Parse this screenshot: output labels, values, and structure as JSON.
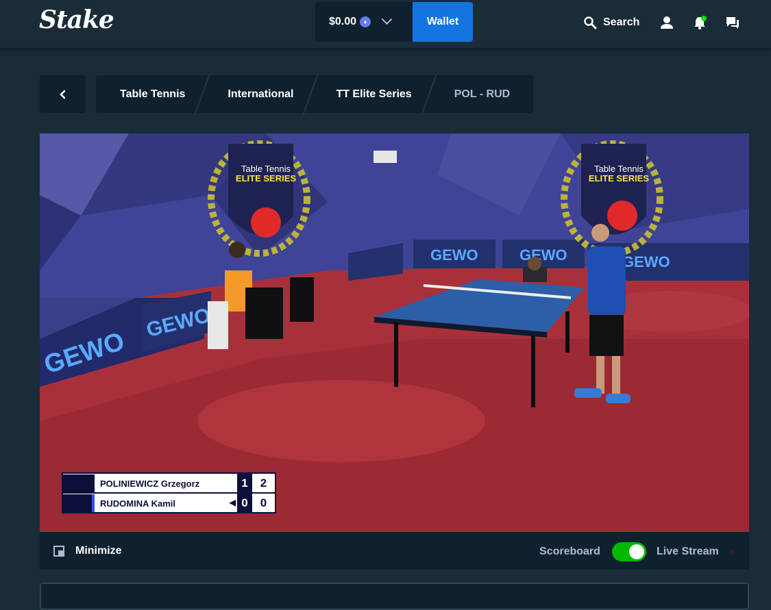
{
  "header": {
    "logo": "Stake",
    "balance": "$0.00",
    "currency_icon": "ethereum-icon",
    "wallet_label": "Wallet",
    "search_label": "Search"
  },
  "breadcrumb": {
    "items": [
      {
        "label": "Table Tennis"
      },
      {
        "label": "International"
      },
      {
        "label": "TT Elite Series"
      },
      {
        "label": "POL - RUD"
      }
    ]
  },
  "video": {
    "banner_title_line1": "Table Tennis",
    "banner_title_line2": "ELITE SERIES",
    "sponsor": "GEWO",
    "scoreboard": {
      "players": [
        {
          "name": "POLINIEWICZ Grzegorz",
          "sets": "1",
          "points": "2",
          "serving": false
        },
        {
          "name": "RUDOMINA Kamil",
          "sets": "0",
          "points": "0",
          "serving": true
        }
      ]
    }
  },
  "controls": {
    "minimize_label": "Minimize",
    "scoreboard_label": "Scoreboard",
    "live_stream_label": "Live Stream",
    "toggle_on": true
  },
  "colors": {
    "bg": "#1a2c38",
    "panel": "#0f212e",
    "accent": "#1475e1",
    "toggle": "#00b801"
  }
}
